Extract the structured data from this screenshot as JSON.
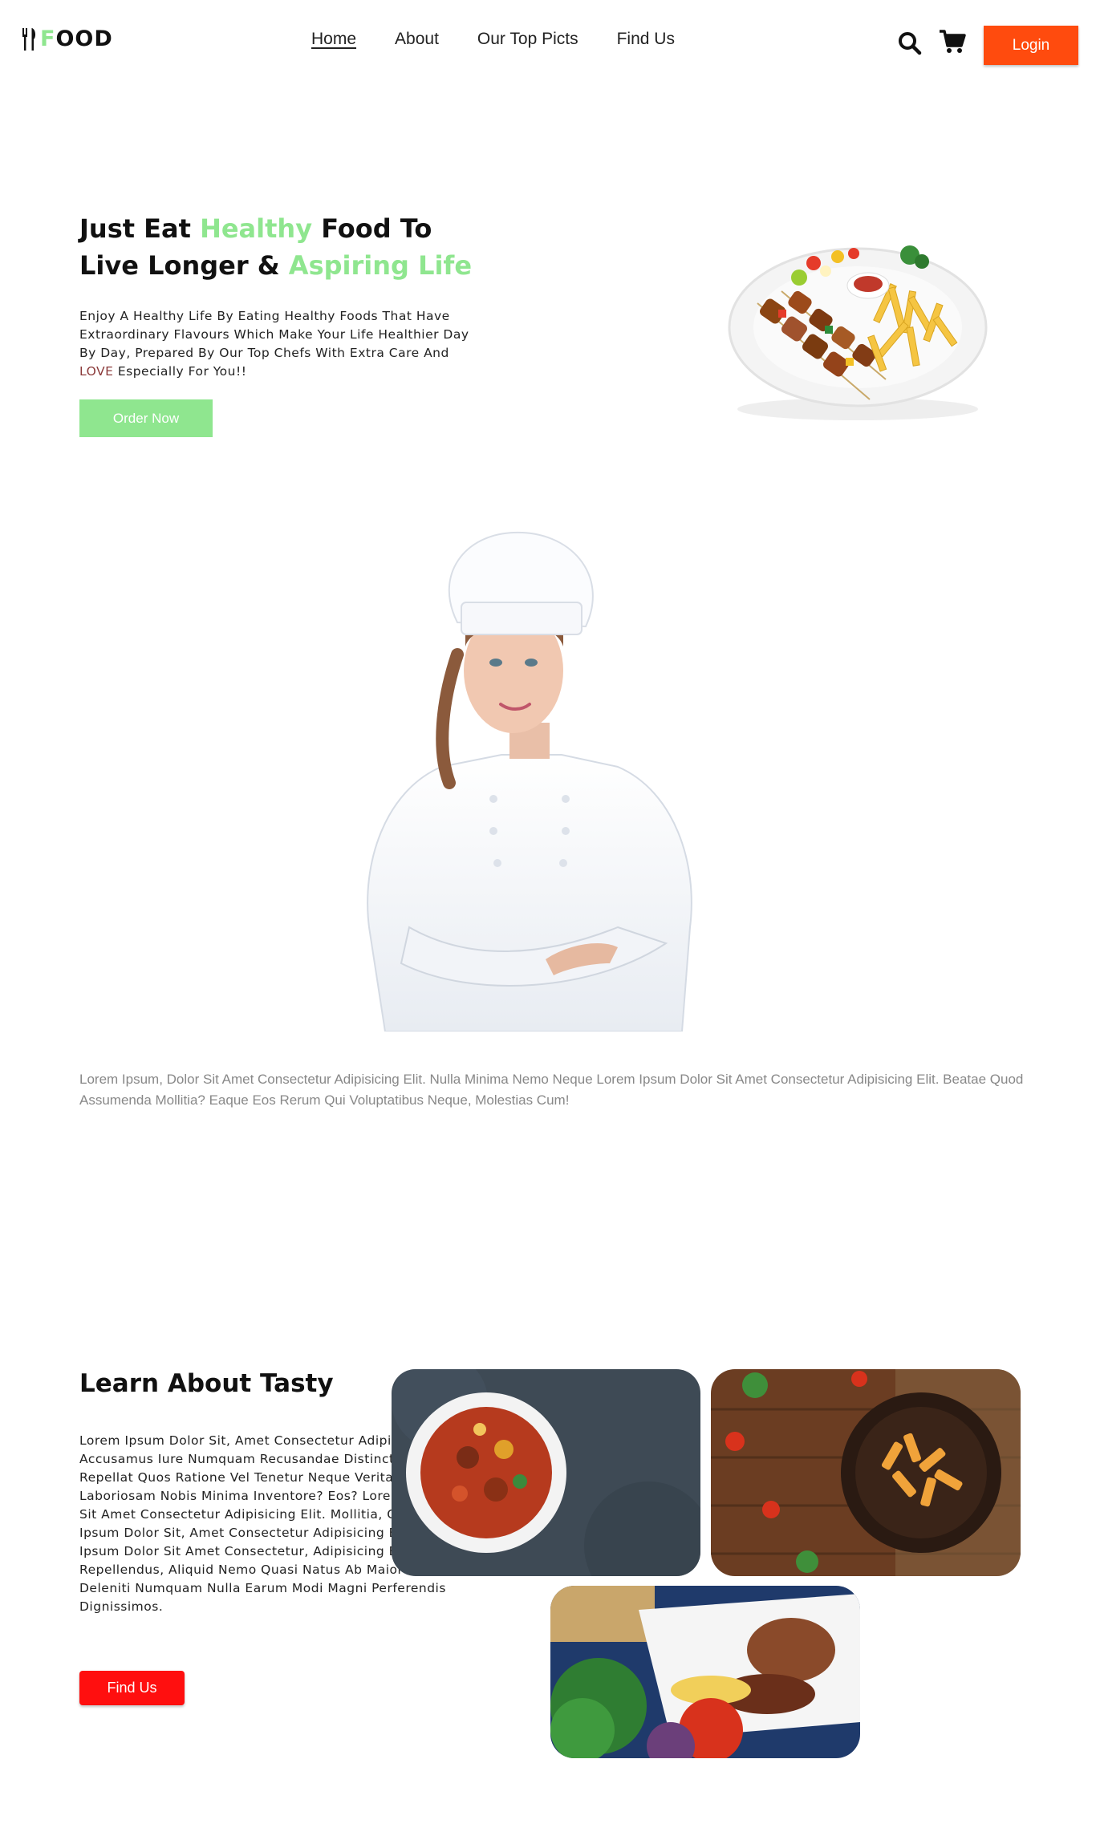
{
  "nav": {
    "logo_text": "OOD",
    "logo_first_letter": "F",
    "items": [
      {
        "label": "Home",
        "active": true
      },
      {
        "label": "About"
      },
      {
        "label": "Our Top Picts"
      },
      {
        "label": "Find Us"
      }
    ],
    "search_icon": "search-icon",
    "cart_icon": "cart-icon",
    "login_label": "Login"
  },
  "hero": {
    "title_part1": "Just Eat ",
    "title_highlight1": "Healthy",
    "title_part2": " Food To",
    "title_part3": "Live Longer & ",
    "title_highlight2": "Aspiring Life",
    "desc_line1": "Enjoy A Healthy Life By Eating Healthy Foods That Have",
    "desc_line2": "Extraordinary Flavours Which Make Your Life Healthier Day",
    "desc_line3": "By Day, Prepared By Our Top Chefs With Extra Care And",
    "desc_love": "LOVE",
    "desc_end": " Especially For You!!",
    "order_label": "Order Now"
  },
  "about": {
    "lorem": "Lorem Ipsum, Dolor Sit Amet Consectetur Adipisicing Elit. Nulla Minima Nemo Neque Lorem Ipsum Dolor Sit Amet Consectetur Adipisicing Elit. Beatae Quod Assumenda Mollitia? Eaque Eos Rerum Qui Voluptatibus Neque, Molestias Cum!"
  },
  "learn": {
    "title": "Learn About Tasty",
    "desc": "Lorem Ipsum Dolor Sit, Amet Consectetur Adipisicing Elit. Minus Accusamus Iure Numquam Recusandae Distinctio, Itaque Eaque Repellat Quos Ratione Vel Tenetur Neque Veritatis Incidunt In Laboriosam Nobis Minima Inventore? Eos? Lorem Ipsum Dolor Sit Amet Consectetur Adipisicing Elit. Mollitia, Quo?Lorem Ipsum Dolor Sit, Amet Consectetur Adipisicing Elit. Alias, Lorem Ipsum Dolor Sit Amet Consectetur, Adipisicing Elit. Autem Repellendus, Aliquid Nemo Quasi Natus Ab Maiores Totam Deleniti Numquam Nulla Earum Modi Magni Perferendis Dignissimos.",
    "findus_label": "Find Us"
  },
  "colors": {
    "accent_green": "#8fe68f",
    "login_orange": "#ff4b0e",
    "findus_red": "#ff0f0f"
  }
}
